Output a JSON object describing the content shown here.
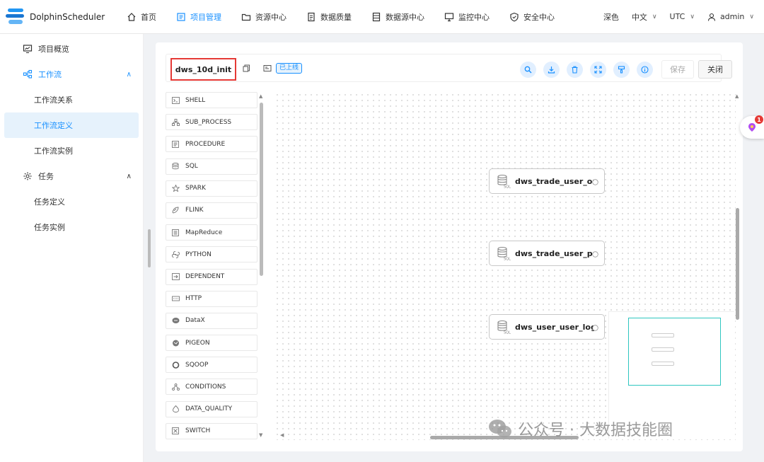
{
  "app": {
    "name": "DolphinScheduler"
  },
  "nav": [
    {
      "label": "首页",
      "icon": "home-icon",
      "active": false
    },
    {
      "label": "项目管理",
      "icon": "project-icon",
      "active": true
    },
    {
      "label": "资源中心",
      "icon": "folder-icon",
      "active": false
    },
    {
      "label": "数据质量",
      "icon": "quality-icon",
      "active": false
    },
    {
      "label": "数据源中心",
      "icon": "datasource-icon",
      "active": false
    },
    {
      "label": "监控中心",
      "icon": "monitor-icon",
      "active": false
    },
    {
      "label": "安全中心",
      "icon": "shield-icon",
      "active": false
    }
  ],
  "header_right": {
    "theme": "深色",
    "language": "中文",
    "timezone": "UTC",
    "user": "admin"
  },
  "sidebar": {
    "overview": "项目概览",
    "workflow": "工作流",
    "workflow_relation": "工作流关系",
    "workflow_definition": "工作流定义",
    "workflow_instance": "工作流实例",
    "task": "任务",
    "task_definition": "任务定义",
    "task_instance": "任务实例"
  },
  "toolbar": {
    "workflow_name": "dws_10d_init",
    "status_badge": "已上线",
    "save_label": "保存",
    "close_label": "关闭"
  },
  "palette": [
    {
      "label": "SHELL",
      "icon": "shell-icon"
    },
    {
      "label": "SUB_PROCESS",
      "icon": "sub-process-icon"
    },
    {
      "label": "PROCEDURE",
      "icon": "procedure-icon"
    },
    {
      "label": "SQL",
      "icon": "sql-icon"
    },
    {
      "label": "SPARK",
      "icon": "spark-icon"
    },
    {
      "label": "FLINK",
      "icon": "flink-icon"
    },
    {
      "label": "MapReduce",
      "icon": "mapreduce-icon"
    },
    {
      "label": "PYTHON",
      "icon": "python-icon"
    },
    {
      "label": "DEPENDENT",
      "icon": "dependent-icon"
    },
    {
      "label": "HTTP",
      "icon": "http-icon"
    },
    {
      "label": "DataX",
      "icon": "datax-icon"
    },
    {
      "label": "PIGEON",
      "icon": "pigeon-icon"
    },
    {
      "label": "SQOOP",
      "icon": "sqoop-icon"
    },
    {
      "label": "CONDITIONS",
      "icon": "conditions-icon"
    },
    {
      "label": "DATA_QUALITY",
      "icon": "data-quality-icon"
    },
    {
      "label": "SWITCH",
      "icon": "switch-icon"
    }
  ],
  "canvas": {
    "nodes": [
      {
        "label": "dws_trade_user_ord",
        "type": "SQL"
      },
      {
        "label": "dws_trade_user_pay",
        "type": "SQL"
      },
      {
        "label": "dws_user_user_logi...",
        "type": "SQL"
      }
    ]
  },
  "float_badge": {
    "count": "1"
  },
  "watermark": {
    "text": "公众号 · 大数据技能圈"
  },
  "colors": {
    "accent": "#1890ff",
    "highlight_border": "#e53935",
    "minimap_view": "#2ec6c0"
  }
}
